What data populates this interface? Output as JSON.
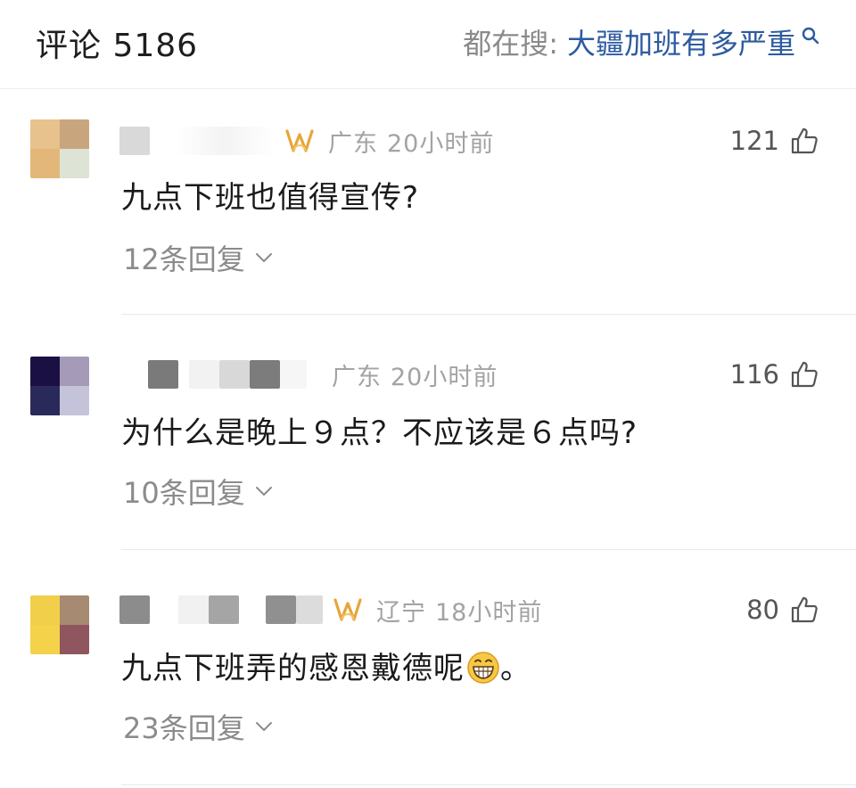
{
  "header": {
    "comments_title": "评论 5186",
    "trending_label": "都在搜:",
    "trending_topic": "大疆加班有多严重",
    "search_icon": "search-icon"
  },
  "comments": [
    {
      "location": "广东",
      "time": "20小时前",
      "likes": "121",
      "text": "九点下班也值得宣传?",
      "replies": "12条回复",
      "has_vip_badge": true
    },
    {
      "location": "广东",
      "time": "20小时前",
      "likes": "116",
      "text": "为什么是晚上９点？不应该是６点吗?",
      "replies": "10条回复",
      "has_vip_badge": false
    },
    {
      "location": "辽宁",
      "time": "18小时前",
      "likes": "80",
      "text": "九点下班弄的感恩戴德呢",
      "text_suffix": "。",
      "replies": "23条回复",
      "has_vip_badge": true,
      "emoji": "grinning-face-emoji"
    }
  ],
  "colors": {
    "trending_topic": "#2d5aa0",
    "vip_badge": "#e8a53a",
    "meta_gray": "#a3a3a3"
  }
}
